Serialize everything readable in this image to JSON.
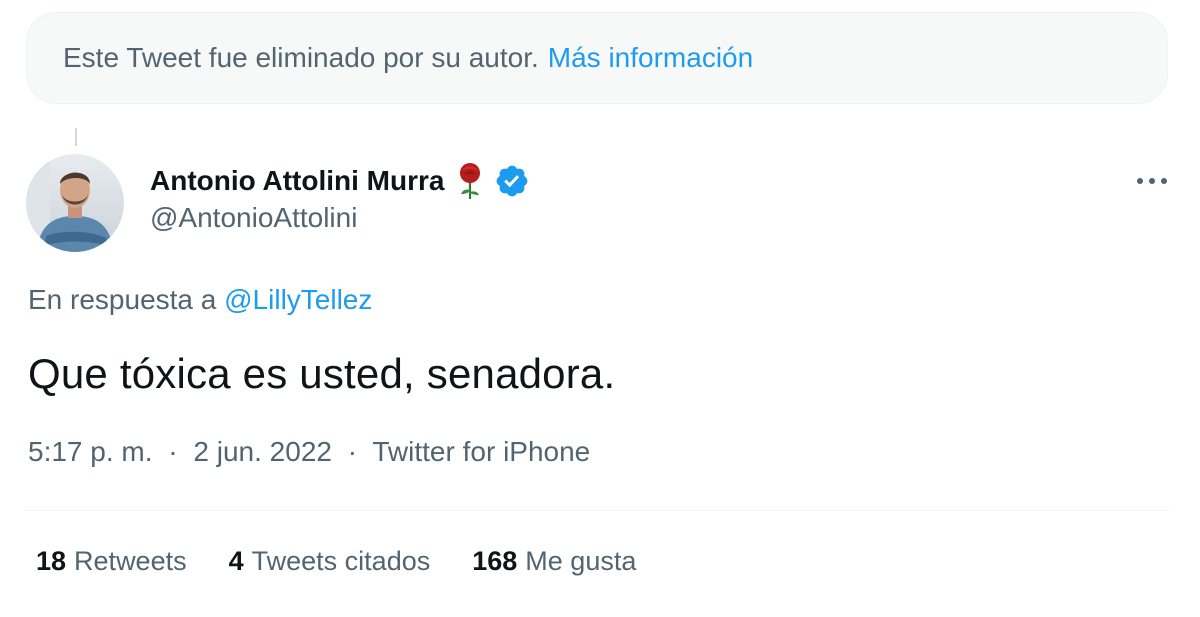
{
  "banner": {
    "text": "Este Tweet fue eliminado por su autor.",
    "link_label": "Más información"
  },
  "author": {
    "display_name": "Antonio Attolini Murra",
    "handle": "@AntonioAttolini",
    "badge_emoji_icon": "rose-icon",
    "verified_icon": "verified-badge-icon"
  },
  "reply": {
    "prefix": "En respuesta a",
    "mention": "@LillyTellez"
  },
  "tweet": {
    "text": "Que tóxica es usted, senadora."
  },
  "meta": {
    "time": "5:17 p. m.",
    "separator": "·",
    "date": "2 jun. 2022",
    "source": "Twitter for iPhone"
  },
  "stats": [
    {
      "count": "18",
      "label": "Retweets"
    },
    {
      "count": "4",
      "label": "Tweets citados"
    },
    {
      "count": "168",
      "label": "Me gusta"
    }
  ],
  "colors": {
    "accent": "#1d9bf0",
    "secondary_text": "#536471",
    "primary_text": "#0f1419",
    "banner_bg": "#f7f9f9"
  }
}
